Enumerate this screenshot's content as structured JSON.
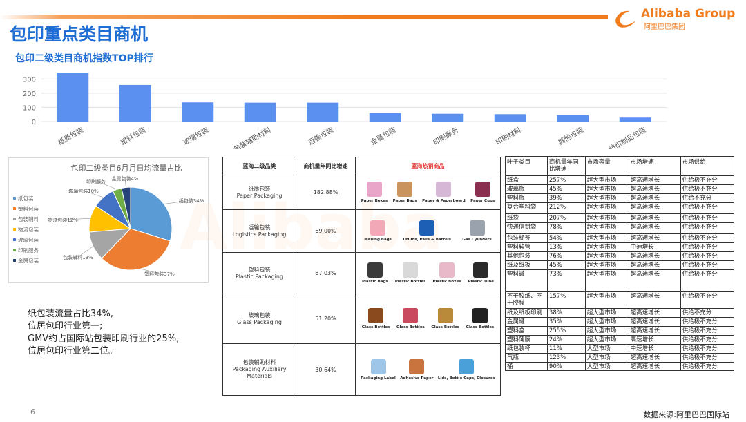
{
  "header": {
    "title": "包印重点类目商机",
    "subtitle": "包印二级类目商机指数TOP排行",
    "logo_brand": "Alibaba Group",
    "logo_cn": "阿里巴巴集团"
  },
  "chart_data": [
    {
      "type": "bar",
      "categories": [
        "纸质包装",
        "塑料包装",
        "玻璃包装",
        "包装辅助材料",
        "运输包装",
        "金属包装",
        "印刷服务",
        "印刷材料",
        "其他包装",
        "纺织制品包装"
      ],
      "values": [
        345,
        258,
        135,
        133,
        133,
        60,
        55,
        52,
        45,
        28
      ],
      "ylim": [
        0,
        350
      ],
      "yticks": [
        0,
        100,
        200,
        300
      ],
      "color": "#5b8ff0"
    },
    {
      "type": "pie",
      "title": "包印二级类目6月月日均流量占比",
      "legend": [
        "纸包装",
        "塑料包装",
        "包装辅料",
        "物流包装",
        "玻璃包装",
        "印刷服务",
        "金属包装"
      ],
      "values": [
        34,
        37,
        13,
        12,
        10,
        4,
        4
      ],
      "slice_labels": [
        "纸包装34%",
        "塑料包装37%",
        "包装辅料13%",
        "物流包装12%",
        "玻璃包装10%",
        "印刷服务",
        "金属包装4%"
      ],
      "colors": [
        "#5b9bd5",
        "#ed7d31",
        "#a5a5a5",
        "#ffc000",
        "#4472c4",
        "#70ad47",
        "#264478"
      ],
      "legend_position": "left"
    }
  ],
  "summary": [
    "纸包装流量占比34%,",
    "位居包印行业第一;",
    "GMV约占国际站包装印刷行业的25%,",
    "位居包印行业第二位。"
  ],
  "page_number": "6",
  "source": "数据来源:阿里巴巴国际站",
  "mid_table": {
    "headers": [
      "蓝海二级品类",
      "商机量年同比增速",
      "蓝海热销商品"
    ],
    "rows": [
      {
        "cn": "纸质包装",
        "en": "Paper Packaging",
        "growth": "182.88%",
        "products": [
          "Paper Boxes",
          "Paper Bags",
          "Paper & Paperboard",
          "Paper Cups"
        ]
      },
      {
        "cn": "运输包装",
        "en": "Logistics Packaging",
        "growth": "69.00%",
        "products": [
          "Mailing Bags",
          "Drums, Pails & Barrels",
          "Gas Cylinders"
        ]
      },
      {
        "cn": "塑料包装",
        "en": "Plastic Packaging",
        "growth": "67.03%",
        "products": [
          "Plastic Bags",
          "Plastic Bottles",
          "Plastic Boxes",
          "Plastic Tube"
        ]
      },
      {
        "cn": "玻璃包装",
        "en": "Glass Packaging",
        "growth": "51.20%",
        "products": [
          "Glass Bottles",
          "Glass Bottles",
          "Glass Bottles",
          "Glass Bottles"
        ]
      },
      {
        "cn": "包装辅助材料",
        "en": "Packaging Auxiliary Materials",
        "growth": "30.64%",
        "products": [
          "Packaging Label",
          "Adhesive Paper",
          "Lids, Bottle Caps, Closures"
        ]
      }
    ]
  },
  "right_table": {
    "headers": [
      "叶子类目",
      "商机量年同比增速",
      "市场容量",
      "市场增速",
      "市场供给"
    ],
    "rows": [
      [
        "纸盒",
        "257%",
        "超大型市场",
        "超高速增长",
        "供给极不充分"
      ],
      [
        "玻璃瓶",
        "45%",
        "超大型市场",
        "超高速增长",
        "供给极不充分"
      ],
      [
        "塑料瓶",
        "39%",
        "超大型市场",
        "超高速增长",
        "供给不充分"
      ],
      [
        "复合塑料袋",
        "212%",
        "超大型市场",
        "超高速增长",
        "供给极不充分"
      ],
      [
        "纸袋",
        "207%",
        "超大型市场",
        "超高速增长",
        "供给极不充分"
      ],
      [
        "快递信封袋",
        "78%",
        "超大型市场",
        "超高速增长",
        "供给极不充分"
      ],
      [
        "包装标签",
        "54%",
        "超大型市场",
        "超高速增长",
        "供给极不充分"
      ],
      [
        "塑料软管",
        "13%",
        "超大型市场",
        "中速增长",
        "供给极不充分"
      ],
      [
        "其他包装",
        "76%",
        "超大型市场",
        "超高速增长",
        "供给极不充分"
      ],
      [
        "纸及纸板",
        "45%",
        "超大型市场",
        "超高速增长",
        "供给极不充分"
      ],
      [
        "塑料罐",
        "73%",
        "超大型市场",
        "超高速增长",
        "供给极不充分"
      ],
      [
        "不干胶纸、不干胶膜",
        "157%",
        "超大型市场",
        "超高速增长",
        "供给极不充分"
      ],
      [
        "纸及纸板印刷",
        "38%",
        "超大型市场",
        "超高速增长",
        "供给不充分"
      ],
      [
        "金属罐",
        "35%",
        "超大型市场",
        "超高速增长",
        "供给极不充分"
      ],
      [
        "塑料盒",
        "255%",
        "超大型市场",
        "超高速增长",
        "供给极不充分"
      ],
      [
        "塑料薄膜",
        "24%",
        "超大型市场",
        "高速增长",
        "供给极不充分"
      ],
      [
        "纸包装杯",
        "11%",
        "大型市场",
        "中速增长",
        "供给极不充分"
      ],
      [
        "气瓶",
        "123%",
        "大型市场",
        "超高速增长",
        "供给极不充分"
      ],
      [
        "桶",
        "90%",
        "大型市场",
        "超高速增长",
        "供给极不充分"
      ]
    ]
  }
}
